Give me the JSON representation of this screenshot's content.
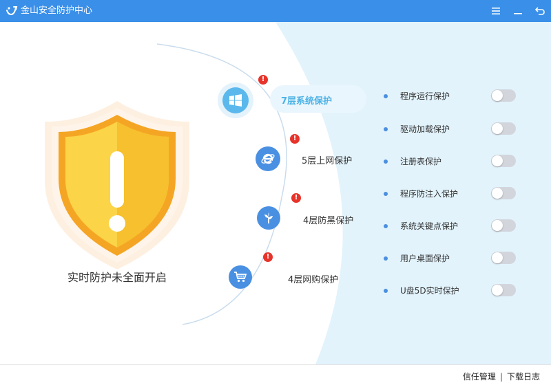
{
  "app": {
    "title": "金山安全防护中心",
    "accent": "#3a8fe8",
    "controls": [
      "menu-icon",
      "minimize-icon",
      "back-icon"
    ]
  },
  "status": {
    "text": "实时防护未全面开启",
    "shield_icon": "warning-shield-icon",
    "shield_color": "#f7c531"
  },
  "layers": [
    {
      "label": "7层系统保护",
      "icon": "windows-icon",
      "active": true,
      "warning": true
    },
    {
      "label": "5层上网保护",
      "icon": "ie-browser-icon",
      "active": false,
      "warning": true
    },
    {
      "label": "4层防黑保护",
      "icon": "plant-icon",
      "active": false,
      "warning": true
    },
    {
      "label": "4层网购保护",
      "icon": "cart-icon",
      "active": false,
      "warning": true
    }
  ],
  "protections": [
    {
      "label": "程序运行保护",
      "enabled": false
    },
    {
      "label": "驱动加载保护",
      "enabled": false
    },
    {
      "label": "注册表保护",
      "enabled": false
    },
    {
      "label": "程序防注入保护",
      "enabled": false
    },
    {
      "label": "系统关键点保护",
      "enabled": false
    },
    {
      "label": "用户桌面保护",
      "enabled": false
    },
    {
      "label": "U盘5D实时保护",
      "enabled": false
    }
  ],
  "footer": {
    "trust_label": "信任管理",
    "separator": "|",
    "log_label": "下载日志"
  }
}
